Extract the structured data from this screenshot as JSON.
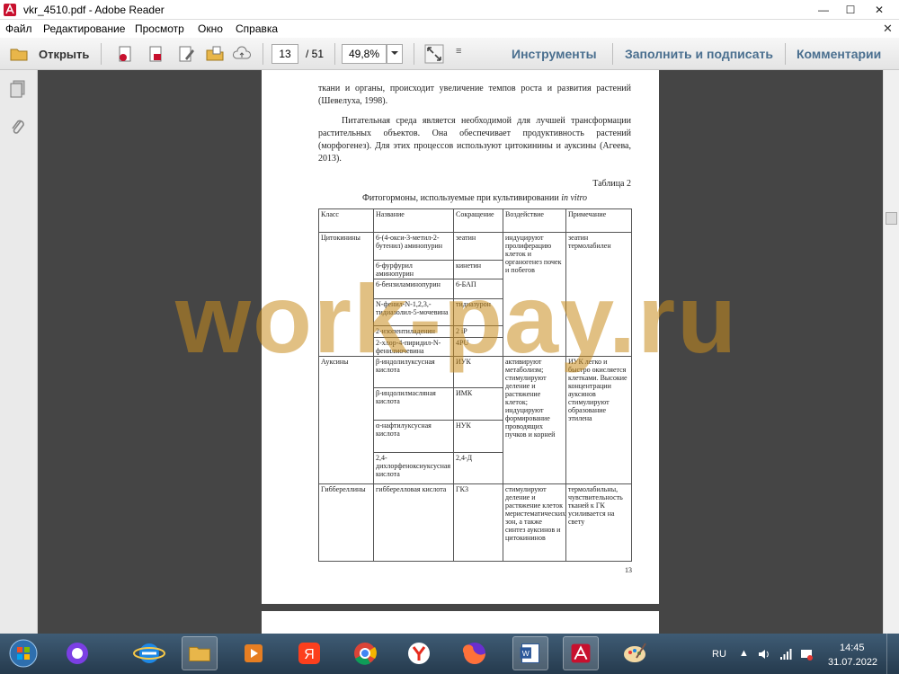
{
  "window": {
    "title": "vkr_4510.pdf - Adobe Reader",
    "min": "—",
    "max": "☐",
    "close": "✕"
  },
  "menu": [
    "Файл",
    "Редактирование",
    "Просмотр",
    "Окно",
    "Справка"
  ],
  "toolbar": {
    "open_label": "Открыть",
    "page_current": "13",
    "page_total": "/ 51",
    "zoom": "49,8%",
    "tools": "Инструменты",
    "fill_sign": "Заполнить и подписать",
    "comments": "Комментарии"
  },
  "page": {
    "p1": "ткани и органы, происходит увеличение темпов роста и развития растений (Шевелуха, 1998).",
    "p2": "Питательная среда является необходимой для лучшей трансформации растительных объектов. Она обеспечивает продуктивность растений (морфогенез). Для этих процессов используют цитокинины и ауксины (Агеева, 2013).",
    "table_num": "Таблица 2",
    "caption": "Фитогормоны, используемые при культивировании ",
    "caption_italic": "in vitro",
    "page_number": "13",
    "headers": [
      "Класс",
      "Название",
      "Сокращение",
      "Воздействие",
      "Примечание"
    ],
    "cyto_class": "Цитокинины",
    "cyto_names": [
      "6-(4-окси-3-метил-2-бутенил) аминопурин",
      "6-фурфурил аминопурин",
      "6-бензиламинопурин",
      "N-фенил-N-1,2,3,-тидиазолил-5-мочевина",
      "2-изопентиладенин",
      "2-хлор-4-пиридил-N-фенилмочевина"
    ],
    "cyto_abbr": [
      "зеатин",
      "кинетин",
      "6-БАП",
      "тидиазурон",
      "2 iP",
      "4PU"
    ],
    "cyto_effect": "индуцируют пролиферацию клеток и органогенез почек и побегов",
    "cyto_note": "зеатин термолабилен",
    "aux_class": "Ауксины",
    "aux_names": [
      "β-индолилуксусная кислота",
      "β-индолилмасляная кислота",
      "α-нафтилуксусная кислота",
      "2,4-дихлорфеноксиуксусная кислота"
    ],
    "aux_abbr": [
      "ИУК",
      "ИМК",
      "НУК",
      "2,4-Д"
    ],
    "aux_effect": "активируют метаболизм; стимулируют деление и растяжение клеток; индуцируют формирование проводящих пучков и корней",
    "aux_note": "ИУК легко и быстро окисляется клетками. Высокие концентрации ауксинов стимулируют образование этилена",
    "gib_class": "Гиббереллины",
    "gib_name": "гибберелловая кислота",
    "gib_abbr": "ГК3",
    "gib_effect": "стимулируют деление и растяжение клеток меристематических зон, а также синтез ауксинов и цитокининов",
    "gib_note": "термолабильны, чувствительность тканей к ГК усиливается на свету"
  },
  "watermark": "work-pay.ru",
  "tray": {
    "lang": "RU",
    "time": "14:45",
    "date": "31.07.2022"
  },
  "colors": {
    "toolbar_label": "#4a6f8f",
    "watermark": "#c88c1e",
    "adobe_red": "#c8102e"
  }
}
